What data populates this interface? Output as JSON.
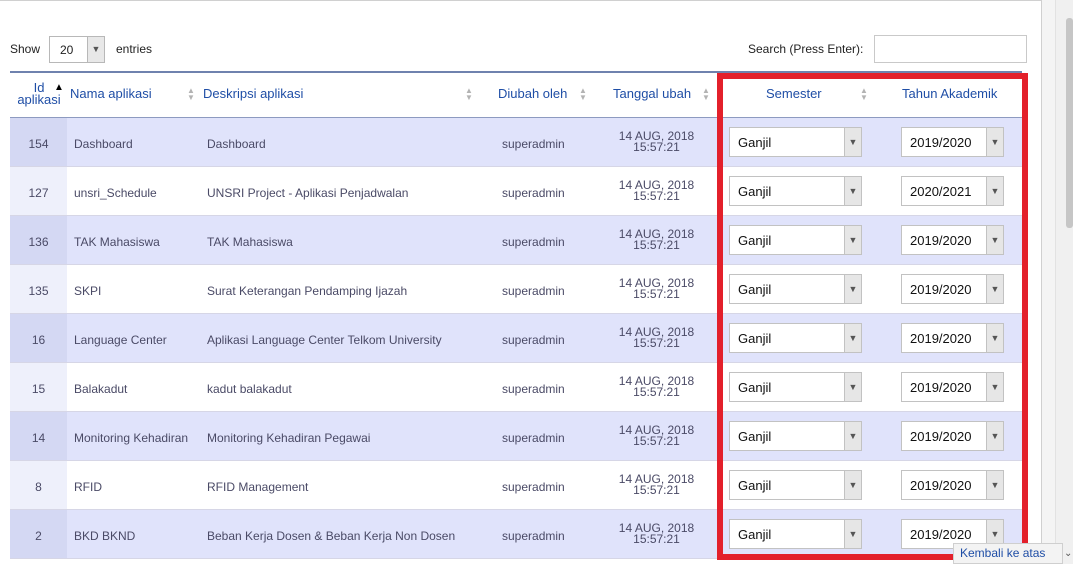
{
  "length_control": {
    "show_label": "Show",
    "value": "20",
    "entries_label": "entries"
  },
  "search": {
    "label": "Search (Press Enter):",
    "value": ""
  },
  "columns": {
    "id": [
      "Id",
      "aplikasi"
    ],
    "name": "Nama aplikasi",
    "description": "Deskripsi aplikasi",
    "updated_by": "Diubah oleh",
    "updated_date": "Tanggal ubah",
    "semester": "Semester",
    "academic_year": "Tahun Akademik"
  },
  "rows": [
    {
      "id": "154",
      "name": "Dashboard",
      "description": "Dashboard",
      "updated_by": "superadmin",
      "date": "14 AUG, 2018",
      "time": "15:57:21",
      "semester": "Ganjil",
      "year": "2019/2020"
    },
    {
      "id": "127",
      "name": "unsri_Schedule",
      "description": "UNSRI Project - Aplikasi Penjadwalan",
      "updated_by": "superadmin",
      "date": "14 AUG, 2018",
      "time": "15:57:21",
      "semester": "Ganjil",
      "year": "2020/2021"
    },
    {
      "id": "136",
      "name": "TAK Mahasiswa",
      "description": "TAK Mahasiswa",
      "updated_by": "superadmin",
      "date": "14 AUG, 2018",
      "time": "15:57:21",
      "semester": "Ganjil",
      "year": "2019/2020"
    },
    {
      "id": "135",
      "name": "SKPI",
      "description": "Surat Keterangan Pendamping Ijazah",
      "updated_by": "superadmin",
      "date": "14 AUG, 2018",
      "time": "15:57:21",
      "semester": "Ganjil",
      "year": "2019/2020"
    },
    {
      "id": "16",
      "name": "Language Center",
      "description": "Aplikasi Language Center Telkom University",
      "updated_by": "superadmin",
      "date": "14 AUG, 2018",
      "time": "15:57:21",
      "semester": "Ganjil",
      "year": "2019/2020"
    },
    {
      "id": "15",
      "name": "Balakadut",
      "description": "kadut balakadut",
      "updated_by": "superadmin",
      "date": "14 AUG, 2018",
      "time": "15:57:21",
      "semester": "Ganjil",
      "year": "2019/2020"
    },
    {
      "id": "14",
      "name": "Monitoring Kehadiran",
      "description": "Monitoring Kehadiran Pegawai",
      "updated_by": "superadmin",
      "date": "14 AUG, 2018",
      "time": "15:57:21",
      "semester": "Ganjil",
      "year": "2019/2020"
    },
    {
      "id": "8",
      "name": "RFID",
      "description": "RFID Management",
      "updated_by": "superadmin",
      "date": "14 AUG, 2018",
      "time": "15:57:21",
      "semester": "Ganjil",
      "year": "2019/2020"
    },
    {
      "id": "2",
      "name": "BKD BKND",
      "description": "Beban Kerja Dosen & Beban Kerja Non Dosen",
      "updated_by": "superadmin",
      "date": "14 AUG, 2018",
      "time": "15:57:21",
      "semester": "Ganjil",
      "year": "2019/2020"
    }
  ],
  "back_to_top": "Kembali ke atas",
  "colors": {
    "highlight": "#e3202b",
    "header_text": "#1f4ea6",
    "odd_row": "#e0e3fb"
  },
  "icons": {
    "dropdown": "chevron-down-icon",
    "sort_asc": "sort-asc-icon",
    "sort": "sort-icon"
  }
}
